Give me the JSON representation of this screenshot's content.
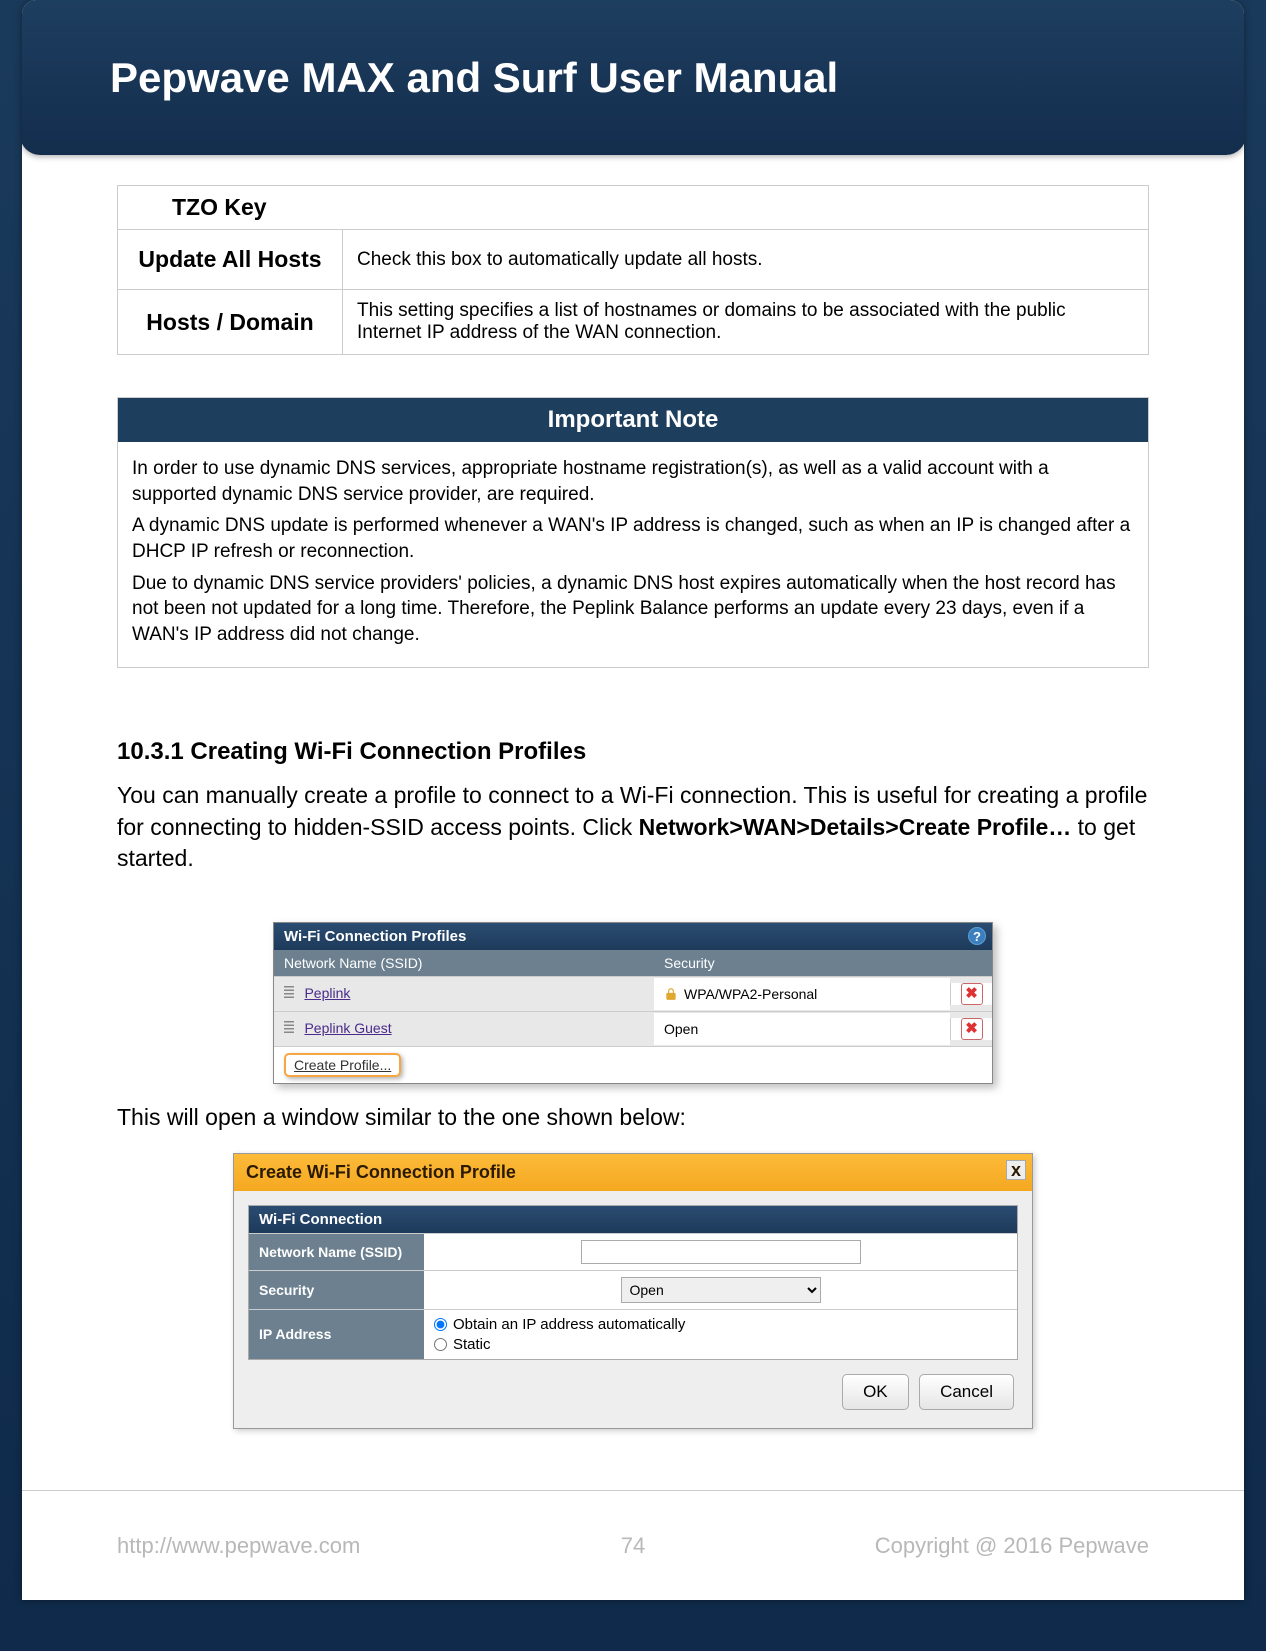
{
  "title": "Pepwave MAX and Surf User Manual",
  "table1": {
    "tzo": "TZO Key",
    "rows": [
      {
        "label": "Update All Hosts",
        "desc": "Check this box to automatically update all hosts."
      },
      {
        "label": "Hosts / Domain",
        "desc": "This setting specifies a list of hostnames or domains to be associated with the public Internet IP address of the WAN connection."
      }
    ]
  },
  "note": {
    "title": "Important Note",
    "p1": "In order to use dynamic DNS services, appropriate hostname registration(s), as well as a valid account with a supported dynamic DNS service provider, are required.",
    "p2": "A dynamic DNS update is performed whenever a WAN's IP address is changed, such as when an IP is changed after a DHCP IP refresh or reconnection.",
    "p3": "Due to dynamic DNS service providers' policies, a dynamic DNS host expires automatically when the host record has not been not updated for a long time. Therefore, the Peplink Balance performs an update every 23 days, even if a WAN's IP address did not change."
  },
  "section": {
    "heading": "10.3.1 Creating Wi-Fi Connection Profiles",
    "para_part1": "You can manually create a profile to connect to a Wi-Fi connection. This is useful for creating a profile for connecting to hidden-SSID access points. Click ",
    "para_bold": "Network>WAN>Details>Create Profile…",
    "para_part2": " to get started.",
    "para2": "This will open a window similar to the one shown below:"
  },
  "shot1": {
    "title": "Wi-Fi Connection Profiles",
    "col1": "Network Name (SSID)",
    "col2": "Security",
    "rows": [
      {
        "name": "Peplink",
        "security": "WPA/WPA2-Personal",
        "locked": true
      },
      {
        "name": "Peplink Guest",
        "security": "Open",
        "locked": false
      }
    ],
    "create": "Create Profile...",
    "help": "?",
    "delete": "✖"
  },
  "shot2": {
    "title": "Create Wi-Fi Connection Profile",
    "close": "x",
    "inner_title": "Wi-Fi Connection",
    "f1_label": "Network Name (SSID)",
    "f2_label": "Security",
    "f2_value": "Open",
    "f3_label": "IP Address",
    "f3_opt1": "Obtain an IP address automatically",
    "f3_opt2": "Static",
    "ok": "OK",
    "cancel": "Cancel"
  },
  "footer": {
    "url": "http://www.pepwave.com",
    "page": "74",
    "copyright": "Copyright @ 2016 Pepwave"
  }
}
